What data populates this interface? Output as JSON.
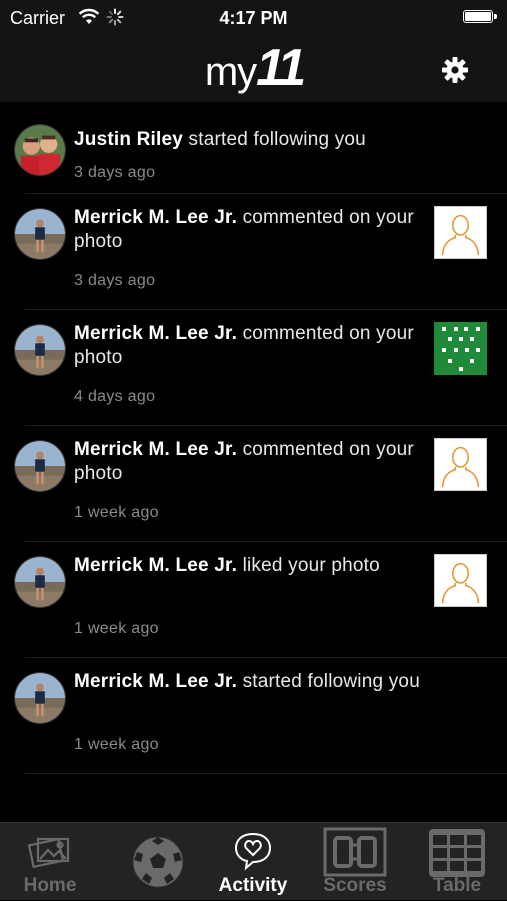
{
  "status_bar": {
    "carrier": "Carrier",
    "time": "4:17 PM"
  },
  "header": {
    "logo_my": "my",
    "logo_num": "11",
    "settings_icon": "gear-icon"
  },
  "feed": {
    "items": [
      {
        "name": "Justin Riley",
        "action": "started following you",
        "time": "3 days ago",
        "thumb": null
      },
      {
        "name": "Merrick M. Lee Jr.",
        "action": "commented on your photo",
        "time": "3 days ago",
        "thumb": "person-placeholder"
      },
      {
        "name": "Merrick M. Lee Jr.",
        "action": "commented on your photo",
        "time": "4 days ago",
        "thumb": "team-formation"
      },
      {
        "name": "Merrick M. Lee Jr.",
        "action": "commented on your photo",
        "time": "1 week ago",
        "thumb": "person-placeholder"
      },
      {
        "name": "Merrick M. Lee Jr.",
        "action": "liked your photo",
        "time": "1 week ago",
        "thumb": "person-placeholder"
      },
      {
        "name": "Merrick M. Lee Jr.",
        "action": "started following you",
        "time": "1 week ago",
        "thumb": null
      }
    ]
  },
  "tab_bar": {
    "tabs": [
      {
        "label": "Home",
        "icon": "photos-icon",
        "active": false
      },
      {
        "label": "",
        "icon": "soccer-ball-icon",
        "active": false
      },
      {
        "label": "Activity",
        "icon": "heart-bubble-icon",
        "active": true
      },
      {
        "label": "Scores",
        "icon": "scoreboard-icon",
        "active": false
      },
      {
        "label": "Table",
        "icon": "grid-table-icon",
        "active": false
      }
    ]
  },
  "colors": {
    "background": "#000000",
    "bar": "#141414",
    "tab_bar": "#232323",
    "muted_text": "#8a8a8a",
    "inactive_tab": "#6a6a6a",
    "placeholder_accent": "#e8922e",
    "formation_green": "#1e8a3a"
  }
}
